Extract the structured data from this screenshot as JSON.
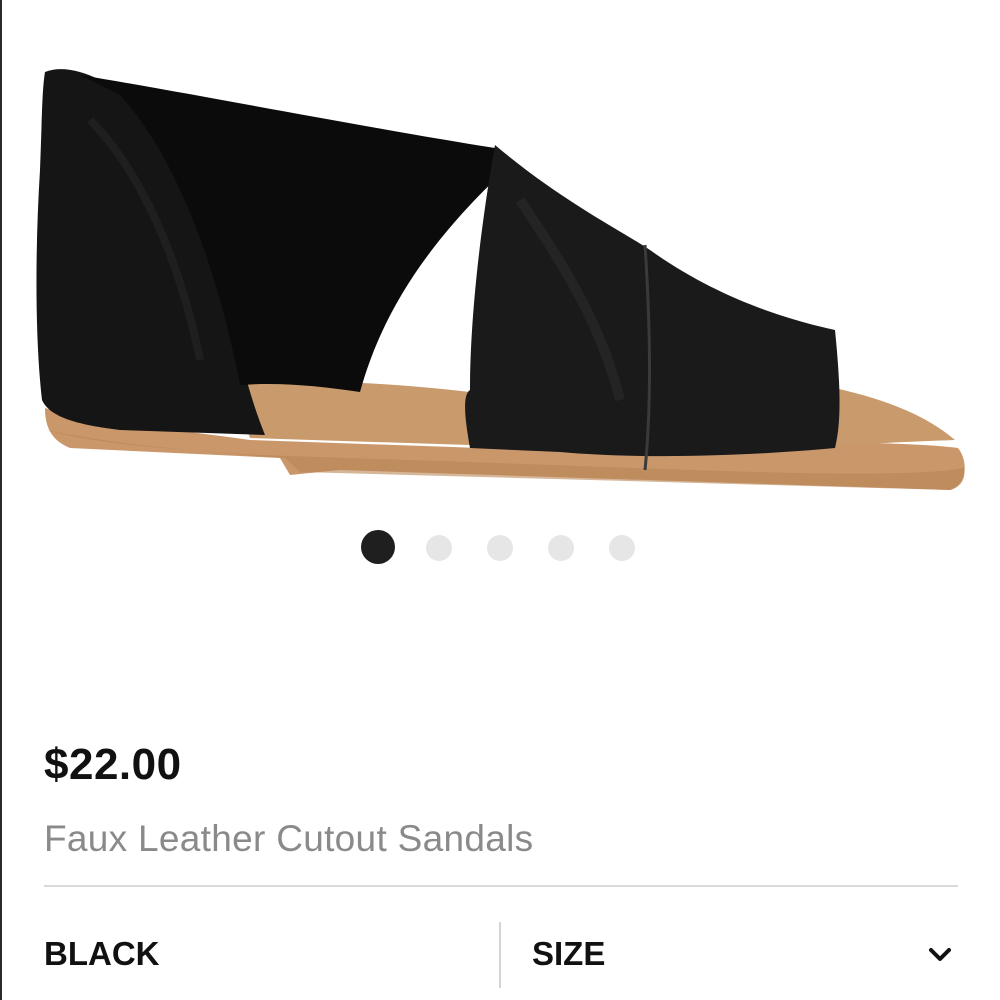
{
  "product": {
    "price": "$22.00",
    "name": "Faux Leather Cutout Sandals",
    "image_subject": "black faux leather cutout sandal"
  },
  "carousel": {
    "total": 5,
    "active_index": 0
  },
  "options": {
    "color_label": "BLACK",
    "size_label": "SIZE",
    "size_icon": "chevron-down-icon"
  },
  "colors": {
    "price_text": "#111111",
    "name_text": "#8a8a8a",
    "dot_active": "#1f1f1f",
    "dot_inactive": "#e6e6e6",
    "shoe_leather": "#151515",
    "sole": "#c9976a"
  }
}
